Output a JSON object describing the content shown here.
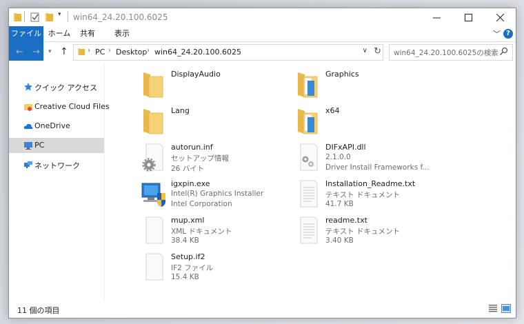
{
  "window": {
    "title": "win64_24.20.100.6025"
  },
  "ribbon": {
    "tabs": [
      "ファイル",
      "ホーム",
      "共有",
      "表示"
    ],
    "help_label": "?"
  },
  "address": {
    "crumbs": [
      "PC",
      "Desktop",
      "win64_24.20.100.6025"
    ]
  },
  "search": {
    "placeholder": "win64_24.20.100.6025の検索"
  },
  "sidebar": {
    "items": [
      {
        "label": "クイック アクセス",
        "icon": "star-icon"
      },
      {
        "label": "Creative Cloud Files",
        "icon": "creative-cloud-folder-icon"
      },
      {
        "label": "OneDrive",
        "icon": "cloud-icon"
      },
      {
        "label": "PC",
        "icon": "computer-icon",
        "selected": true
      },
      {
        "label": "ネットワーク",
        "icon": "network-icon"
      }
    ]
  },
  "files": [
    {
      "name": "DisplayAudio",
      "icon": "folder-icon"
    },
    {
      "name": "Graphics",
      "icon": "folder-docs-icon"
    },
    {
      "name": "Lang",
      "icon": "folder-icon"
    },
    {
      "name": "x64",
      "icon": "folder-docs-icon"
    },
    {
      "name": "autorun.inf",
      "line1": "セットアップ情報",
      "line2": "26 バイト",
      "icon": "settings-file-icon"
    },
    {
      "name": "DIFxAPI.dll",
      "line1": "2.1.0.0",
      "line2": "Driver Install Frameworks f...",
      "icon": "dll-file-icon"
    },
    {
      "name": "igxpin.exe",
      "line1": "Intel(R) Graphics Installer",
      "line2": "Intel Corporation",
      "icon": "installer-exe-icon"
    },
    {
      "name": "Installation_Readme.txt",
      "line1": "テキスト ドキュメント",
      "line2": "41.7 KB",
      "icon": "text-file-icon"
    },
    {
      "name": "mup.xml",
      "line1": "XML ドキュメント",
      "line2": "38.4 KB",
      "icon": "blank-file-icon"
    },
    {
      "name": "readme.txt",
      "line1": "テキスト ドキュメント",
      "line2": "3.40 KB",
      "icon": "text-file-icon"
    },
    {
      "name": "Setup.if2",
      "line1": "IF2 ファイル",
      "line2": "15.4 KB",
      "icon": "blank-file-icon"
    }
  ],
  "status": {
    "item_count": "11 個の項目"
  },
  "colors": {
    "accent": "#1a6fc4",
    "folder": "#f4cc63",
    "selected_nav": "#d9d9d9"
  }
}
